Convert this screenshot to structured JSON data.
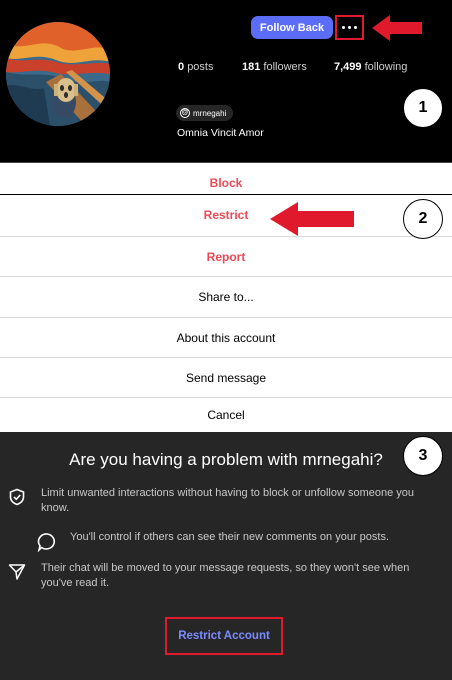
{
  "profile": {
    "username": "mrnegahi",
    "bio": "Omnia Vincit Amor",
    "follow_button": "Follow Back",
    "stats": {
      "posts_value": "0",
      "posts_label": "posts",
      "followers_value": "181",
      "followers_label": "followers",
      "following_value": "7,499",
      "following_label": "following"
    }
  },
  "step_numbers": [
    "1",
    "2",
    "3"
  ],
  "action_sheet": {
    "block": "Block",
    "restrict": "Restrict",
    "report": "Report",
    "share": "Share to...",
    "about": "About this account",
    "message": "Send message",
    "cancel": "Cancel"
  },
  "restrict_dialog": {
    "title": "Are you having a problem with mrnegahi?",
    "reasons": [
      {
        "icon": "shield-icon",
        "text": "Limit unwanted interactions without having to block or unfollow someone you know."
      },
      {
        "icon": "speech-bubble-icon",
        "text": "You'll control if others can see their new comments on your posts."
      },
      {
        "icon": "send-icon",
        "text": "Their chat will be moved to your message requests, so they won't see when you've read it."
      }
    ],
    "button": "Restrict Account"
  },
  "colors": {
    "follow_button": "#5b6df6",
    "danger_text": "#ed4956",
    "highlight_red": "#e0192d",
    "dialog_bg": "#262626",
    "link_blue": "#7c8cff"
  }
}
